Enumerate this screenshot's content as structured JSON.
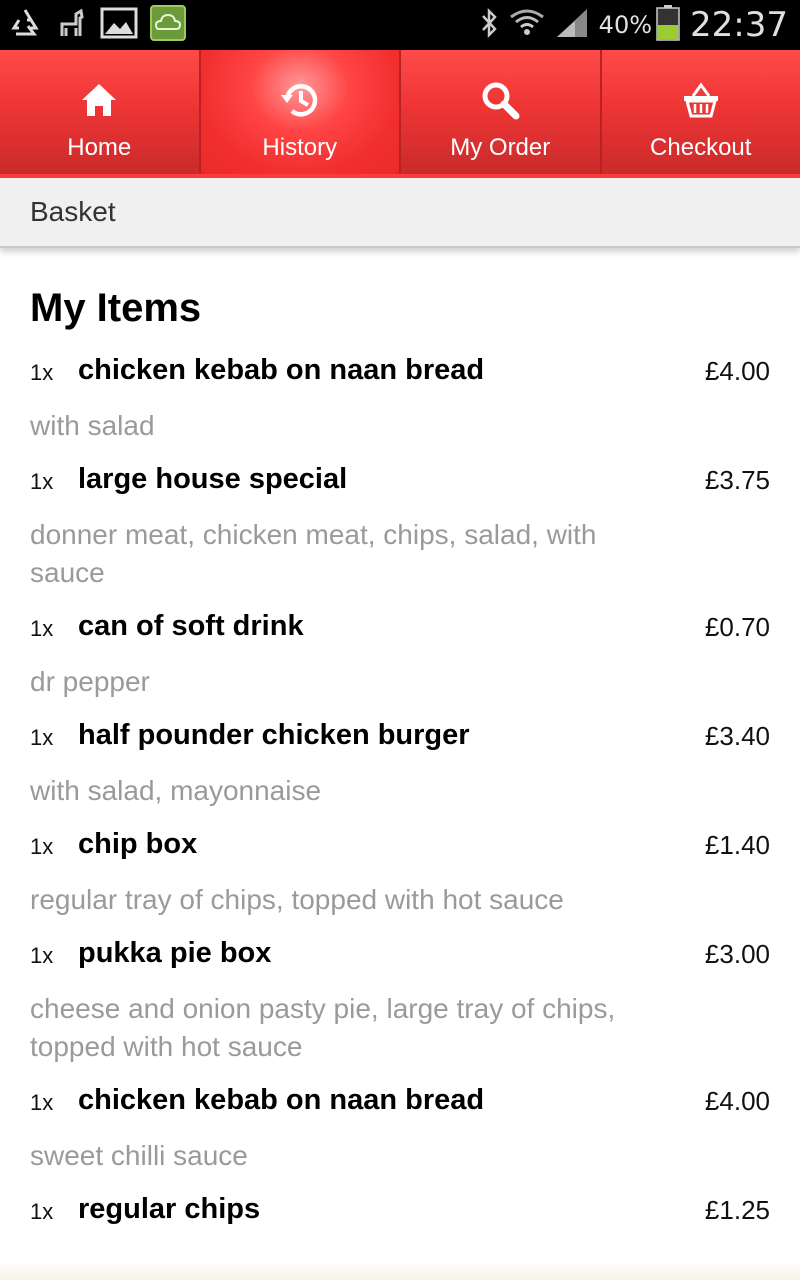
{
  "status_bar": {
    "left_icons": [
      "recycle-icon",
      "llama-icon",
      "image-icon",
      "app-cloud-icon"
    ],
    "battery_percent": "40%",
    "time": "22:37"
  },
  "nav": {
    "tabs": [
      {
        "label": "Home",
        "icon": "home-icon",
        "active": false
      },
      {
        "label": "History",
        "icon": "history-icon",
        "active": true
      },
      {
        "label": "My Order",
        "icon": "search-icon",
        "active": false
      },
      {
        "label": "Checkout",
        "icon": "basket-icon",
        "active": false
      }
    ]
  },
  "basket": {
    "title": "Basket"
  },
  "items_section": {
    "title": "My Items",
    "items": [
      {
        "qty": "1x",
        "name": "chicken kebab on naan bread",
        "price": "£4.00",
        "desc_lines": [
          "with salad"
        ]
      },
      {
        "qty": "1x",
        "name": "large house special",
        "price": "£3.75",
        "desc_lines": [
          "donner meat, chicken meat, chips, salad, with",
          "sauce"
        ]
      },
      {
        "qty": "1x",
        "name": "can of soft drink",
        "price": "£0.70",
        "desc_lines": [
          "dr pepper"
        ]
      },
      {
        "qty": "1x",
        "name": "half pounder chicken burger",
        "price": "£3.40",
        "desc_lines": [
          "with salad, mayonnaise"
        ]
      },
      {
        "qty": "1x",
        "name": "chip box",
        "price": "£1.40",
        "desc_lines": [
          "regular tray of chips, topped with hot sauce"
        ]
      },
      {
        "qty": "1x",
        "name": "pukka pie box",
        "price": "£3.00",
        "desc_lines": [
          "cheese and onion pasty pie, large tray of chips,",
          "topped with hot sauce"
        ]
      },
      {
        "qty": "1x",
        "name": "chicken kebab on naan bread",
        "price": "£4.00",
        "desc_lines": [
          "sweet chilli sauce"
        ]
      },
      {
        "qty": "1x",
        "name": "regular chips",
        "price": "£1.25",
        "desc_lines": []
      }
    ]
  },
  "colors": {
    "nav_red": "#ef3535",
    "desc_grey": "#9a9a9a"
  }
}
